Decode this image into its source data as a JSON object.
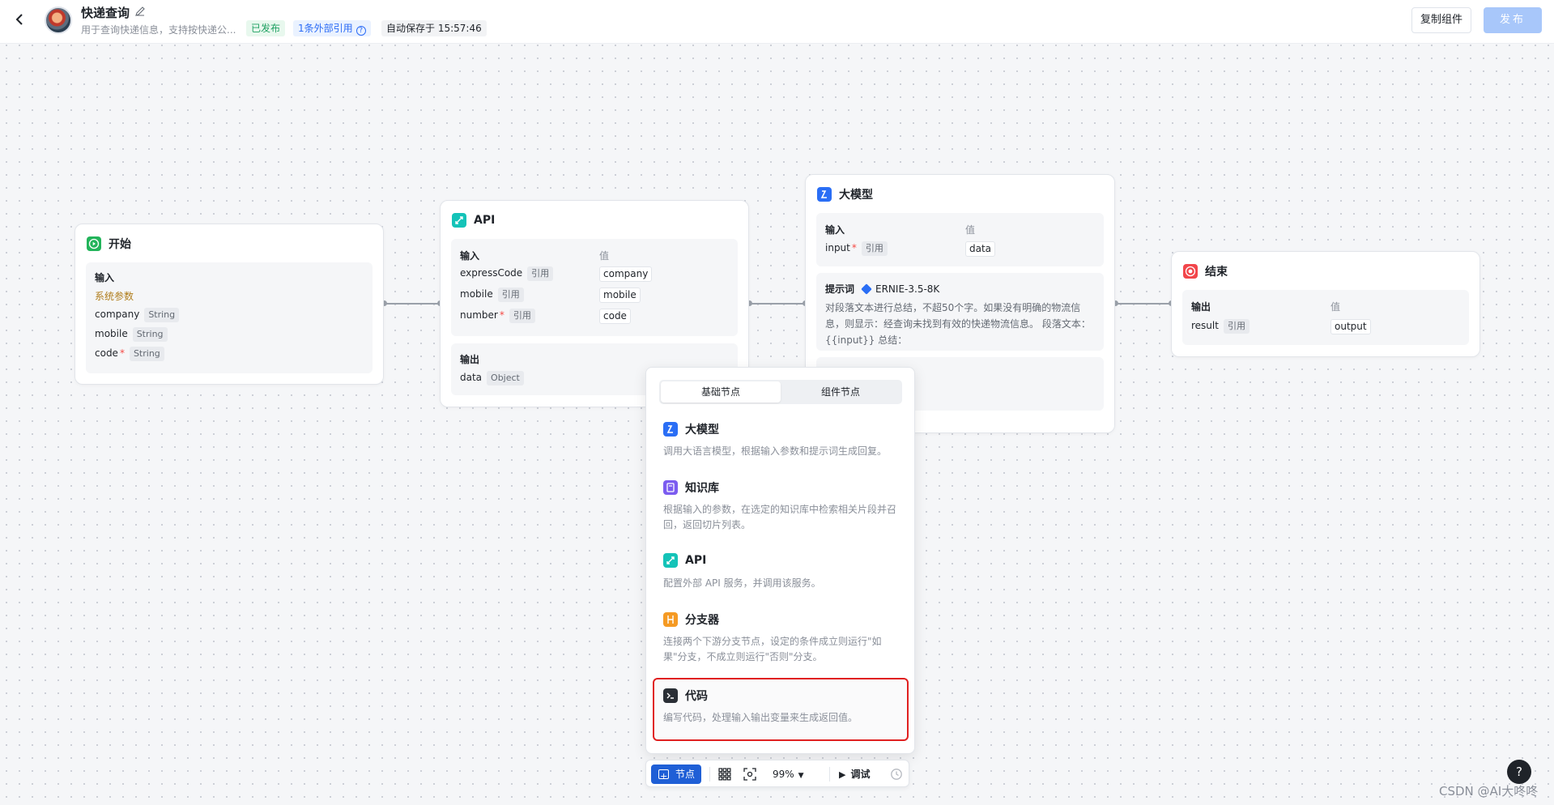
{
  "header": {
    "title": "快递查询",
    "description": "用于查询快递信息，支持按快递公...",
    "status_badge": "已发布",
    "ref_badge": "1条外部引用",
    "autosave": "自动保存于 15:57:46",
    "copy_label": "复制组件",
    "publish_label": "发布"
  },
  "nodes": {
    "start": {
      "title": "开始",
      "input_label": "输入",
      "sys_params": "系统参数",
      "params": [
        {
          "name": "company",
          "type": "String"
        },
        {
          "name": "mobile",
          "type": "String"
        },
        {
          "name": "code",
          "type": "String",
          "req": "*"
        }
      ]
    },
    "api": {
      "title": "API",
      "input_label": "输入",
      "value_label": "值",
      "params": [
        {
          "name": "expressCode",
          "tag": "引用",
          "value": "company"
        },
        {
          "name": "mobile",
          "tag": "引用",
          "value": "mobile"
        },
        {
          "name": "number",
          "req": "*",
          "tag": "引用",
          "value": "code"
        }
      ],
      "output_label": "输出",
      "output": {
        "name": "data",
        "type": "Object"
      }
    },
    "llm": {
      "title": "大模型",
      "input_label": "输入",
      "value_label": "值",
      "input": {
        "name": "input",
        "req": "*",
        "tag": "引用",
        "value": "data"
      },
      "prompt_label": "提示词",
      "model": "ERNIE-3.5-8K",
      "prompt_lines": [
        "对段落文本进行总结，不超50个字。如果没有明确的物流信",
        "息，则显示：经查询未找到有效的快递物流信息。 段落文本：",
        "{{input}} 总结："
      ]
    },
    "end": {
      "title": "结束",
      "output_label": "输出",
      "value_label": "值",
      "output": {
        "name": "result",
        "tag": "引用",
        "value": "output"
      }
    }
  },
  "popup": {
    "tabs": [
      "基础节点",
      "组件节点"
    ],
    "items": [
      {
        "title": "大模型",
        "desc": "调用大语言模型，根据输入参数和提示词生成回复。"
      },
      {
        "title": "知识库",
        "desc": "根据输入的参数，在选定的知识库中检索相关片段并召回，返回切片列表。"
      },
      {
        "title": "API",
        "desc": "配置外部 API 服务，并调用该服务。"
      },
      {
        "title": "分支器",
        "desc": "连接两个下游分支节点，设定的条件成立则运行\"如果\"分支，不成立则运行\"否则\"分支。"
      },
      {
        "title": "代码",
        "desc": "编写代码，处理输入输出变量来生成返回值。"
      }
    ]
  },
  "toolbar": {
    "node_label": "节点",
    "zoom": "99%",
    "debug_label": "调试"
  },
  "help_label": "?",
  "watermark": "CSDN @AI大咚咚",
  "colors": {
    "start_icon": "#22b45a",
    "api_icon": "#14c3b8",
    "llm_icon": "#2a6ef5",
    "end_icon": "#f2464b",
    "kb_icon": "#7b5cf0",
    "branch_icon": "#f59a23",
    "code_icon": "#2b2f36",
    "highlight": "#e02020"
  }
}
